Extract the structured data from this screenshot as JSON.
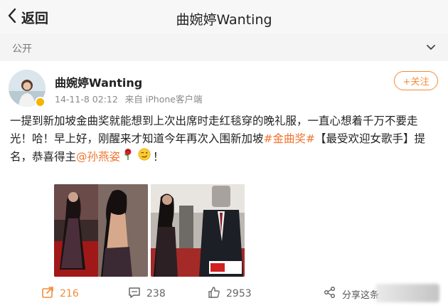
{
  "nav": {
    "back_label": "返回",
    "title": "曲婉婷Wanting"
  },
  "visibility": {
    "label": "公开"
  },
  "post": {
    "author": "曲婉婷Wanting",
    "time": "14-11-8 02:12",
    "source": "来自 iPhone客户端",
    "follow_label": "+关注",
    "text_1": "一提到新加坡金曲奖就能想到上次出席时走红毯穿的晚礼服，一直心想着千万不要走光！哈！早上好，刚醒来才知道今年再次入围新加坡",
    "hashtag": "#金曲奖#",
    "text_2": "【最受欢迎女歌手】提名，恭喜得主",
    "mention": "@孙燕姿",
    "text_3": "！"
  },
  "actions": {
    "share_count": "216",
    "comment_count": "238",
    "like_count": "2953",
    "share_label": "分享这条"
  },
  "colors": {
    "accent": "#f28c3a",
    "link": "#f0742e"
  }
}
